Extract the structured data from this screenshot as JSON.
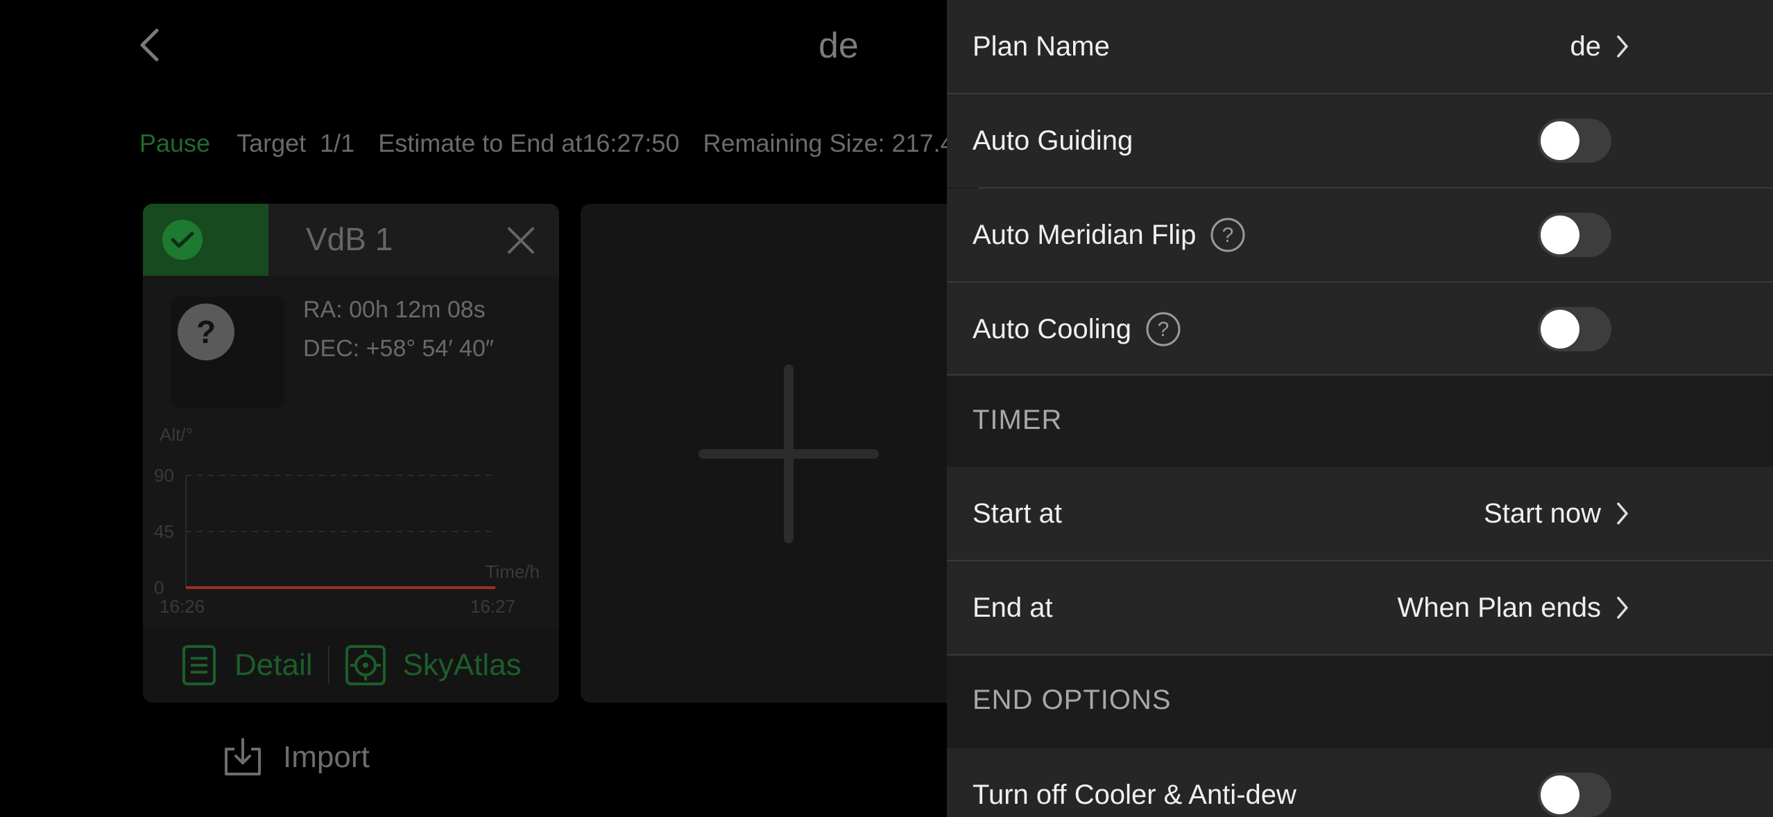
{
  "page": {
    "title": "de",
    "status": {
      "state": "Pause",
      "target_label": "Target",
      "target_progress": "1/1",
      "estimate": "Estimate to End at16:27:50",
      "remaining": "Remaining Size: 217.4"
    }
  },
  "target_card": {
    "name": "VdB 1",
    "ra": "RA: 00h 12m 08s",
    "dec": "DEC: +58° 54′ 40″",
    "detail_label": "Detail",
    "skyatlas_label": "SkyAtlas",
    "chart_data": {
      "type": "line",
      "ylabel": "Alt/°",
      "xlabel": "Time/h",
      "ylim": [
        0,
        90
      ],
      "yticks": [
        "90",
        "45",
        "0"
      ],
      "xticks": [
        "16:26",
        "16:27"
      ],
      "series": [
        {
          "x": [
            "16:26",
            "16:27"
          ],
          "values": [
            0,
            0
          ],
          "color": "#c0392b"
        }
      ],
      "grid": true
    }
  },
  "import_label": "Import",
  "panel": {
    "plan_name_label": "Plan Name",
    "plan_name_value": "de",
    "auto_guiding_label": "Auto Guiding",
    "auto_guiding_on": false,
    "auto_meridian_label": "Auto Meridian Flip",
    "auto_meridian_on": false,
    "auto_cooling_label": "Auto Cooling",
    "auto_cooling_on": false,
    "timer_header": "TIMER",
    "start_at_label": "Start at",
    "start_at_value": "Start now",
    "end_at_label": "End at",
    "end_at_value": "When Plan ends",
    "end_options_header": "END OPTIONS",
    "turn_off_cooler_label": "Turn off Cooler & Anti-dew",
    "turn_off_cooler_on": false
  },
  "colors": {
    "accent_green": "#1f7a31",
    "toggle_off": "#3d3d3d",
    "panel_row": "#262626",
    "panel_bg": "#1c1c1c"
  }
}
